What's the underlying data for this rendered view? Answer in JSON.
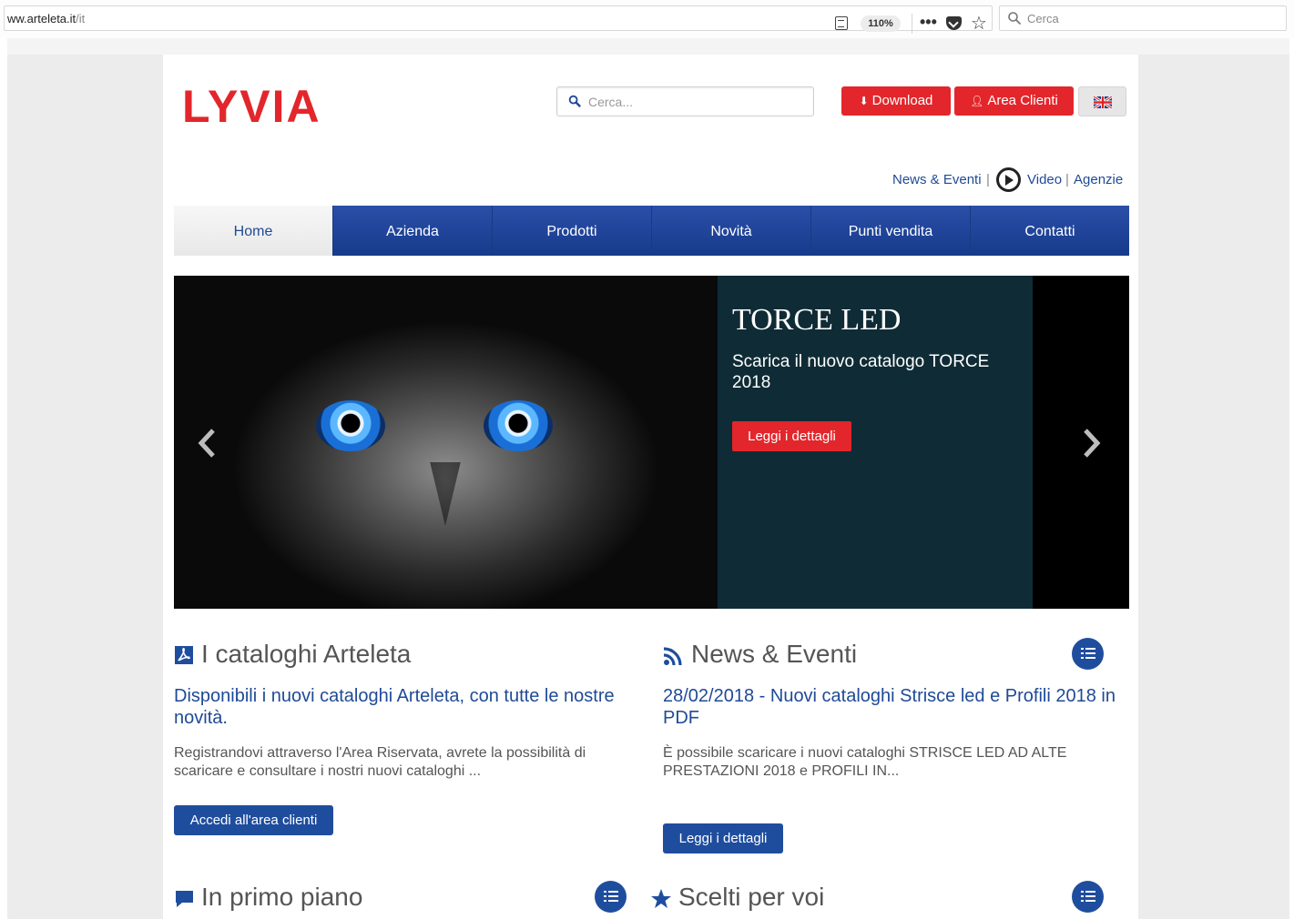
{
  "browser": {
    "url_host": "ww.arteleta.it",
    "url_path": "/it",
    "zoom": "110%",
    "search_placeholder": "Cerca"
  },
  "header": {
    "logo_text": "LYVIA",
    "search_placeholder": "Cerca...",
    "download_label": "Download",
    "area_clienti_label": "Area Clienti",
    "links": {
      "news": "News & Eventi",
      "pipe": "|",
      "video": "Video",
      "agenzie": "Agenzie"
    }
  },
  "nav": {
    "items": [
      {
        "label": "Home"
      },
      {
        "label": "Azienda"
      },
      {
        "label": "Prodotti"
      },
      {
        "label": "Novità"
      },
      {
        "label": "Punti vendita"
      },
      {
        "label": "Contatti"
      }
    ]
  },
  "slider": {
    "title": "TORCE LED",
    "text": "Scarica il nuovo catalogo TORCE 2018",
    "button": "Leggi i dettagli"
  },
  "cataloghi": {
    "title": "I cataloghi Arteleta",
    "link": "Disponibili i nuovi cataloghi Arteleta, con tutte le nostre novità.",
    "text": "Registrandovi attraverso l'Area Riservata, avrete la possibilità di scaricare e consultare i nostri nuovi cataloghi ...",
    "button": "Accedi all'area clienti"
  },
  "news": {
    "title": "News & Eventi",
    "link": "28/02/2018 - Nuovi cataloghi Strisce led e Profili 2018 in PDF",
    "text": "È possibile scaricare i nuovi cataloghi STRISCE LED AD ALTE PRESTAZIONI 2018  e PROFILI IN...",
    "button": "Leggi i dettagli"
  },
  "primo_piano": {
    "title": "In primo piano"
  },
  "scelti": {
    "title": "Scelti per voi"
  },
  "colors": {
    "brand_red": "#e3262b",
    "brand_blue": "#1f4d9e",
    "link_blue": "#1f4a96"
  }
}
